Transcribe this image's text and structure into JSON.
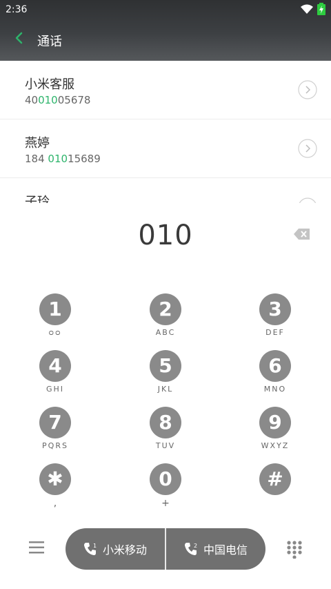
{
  "status": {
    "time": "2:36"
  },
  "header": {
    "title": "通话"
  },
  "contacts": [
    {
      "name": "小米客服",
      "num_before": "40",
      "num_match": "010",
      "num_after": "05678"
    },
    {
      "name": "燕婷",
      "num_before": "184 ",
      "num_match": "010",
      "num_after": "15689"
    },
    {
      "name": "子玲"
    }
  ],
  "display": {
    "value": "010"
  },
  "keys": [
    {
      "digit": "1",
      "sub": "ᴑᴑ"
    },
    {
      "digit": "2",
      "sub": "ABC"
    },
    {
      "digit": "3",
      "sub": "DEF"
    },
    {
      "digit": "4",
      "sub": "GHI"
    },
    {
      "digit": "5",
      "sub": "JKL"
    },
    {
      "digit": "6",
      "sub": "MNO"
    },
    {
      "digit": "7",
      "sub": "PQRS"
    },
    {
      "digit": "8",
      "sub": "TUV"
    },
    {
      "digit": "9",
      "sub": "WXYZ"
    },
    {
      "digit": "✱",
      "sub": ","
    },
    {
      "digit": "0",
      "sub": "+"
    },
    {
      "digit": "#",
      "sub": ""
    }
  ],
  "bottom": {
    "sim1_label": "小米移动",
    "sim2_label": "中国电信"
  },
  "colors": {
    "accent": "#2db46b",
    "key_bg": "#8a8a8a",
    "sim_bg": "#707070"
  }
}
